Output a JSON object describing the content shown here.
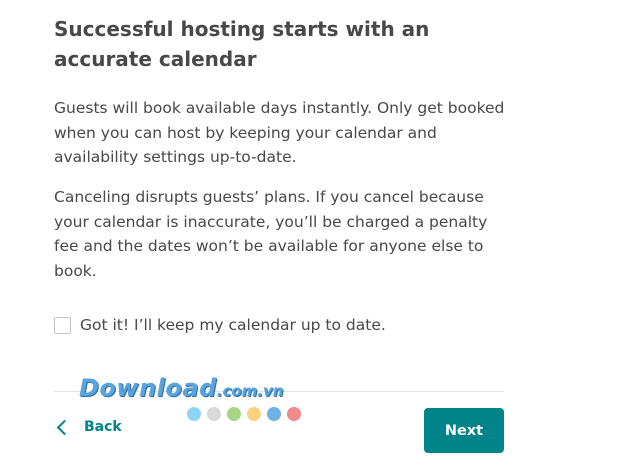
{
  "heading": "Successful hosting starts with an accurate calendar",
  "paragraphs": [
    "Guests will book available days instantly. Only get booked when you can host by keeping your calendar and availability settings up-to-date.",
    "Canceling disrupts guests’ plans. If you cancel because your calendar is inaccurate, you’ll be charged a penalty fee and the dates won’t be available for anyone else to book."
  ],
  "checkbox": {
    "label": "Got it! I’ll keep my calendar up to date.",
    "checked": false
  },
  "watermark": {
    "main": "Download",
    "suffix": ".com.vn"
  },
  "watermark_dots": [
    "#8fd3f4",
    "#d9d9d9",
    "#a6d785",
    "#ffd27f",
    "#6fb1e3",
    "#f08a8a"
  ],
  "footer": {
    "back_label": "Back",
    "next_label": "Next"
  },
  "colors": {
    "accent": "#008489",
    "text": "#484848"
  }
}
